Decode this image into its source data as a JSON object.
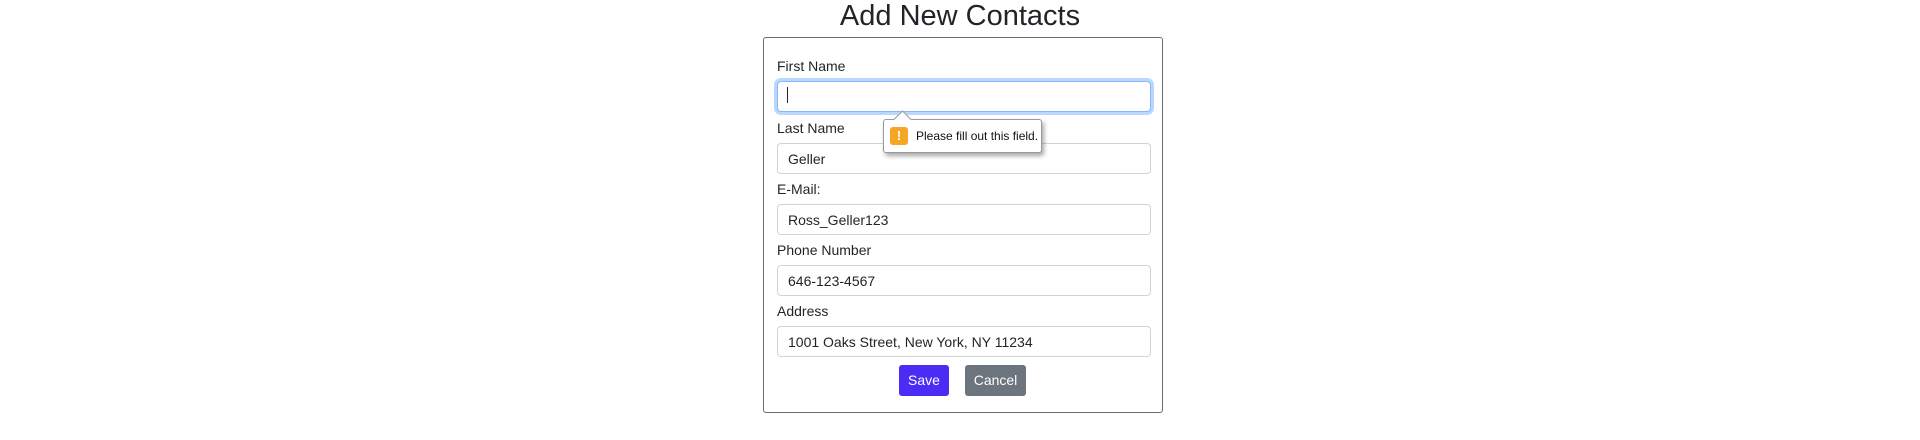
{
  "page": {
    "title": "Add New Contacts"
  },
  "form": {
    "first_name": {
      "label": "First Name",
      "value": ""
    },
    "last_name": {
      "label": "Last Name",
      "value": "Geller"
    },
    "email": {
      "label": "E-Mail:",
      "value": "Ross_Geller123"
    },
    "phone": {
      "label": "Phone Number",
      "value": "646-123-4567"
    },
    "address": {
      "label": "Address",
      "value": "1001 Oaks Street, New York, NY 11234"
    },
    "save_label": "Save",
    "cancel_label": "Cancel"
  },
  "validation": {
    "message": "Please fill out this field.",
    "icon": "warning-icon"
  },
  "colors": {
    "save_button": "#4a2cf5",
    "cancel_button": "#6c757d",
    "focus_ring": "#86b7fe",
    "warning": "#f5a623"
  }
}
